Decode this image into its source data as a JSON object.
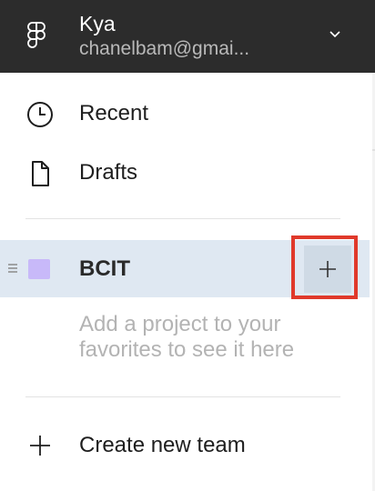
{
  "account": {
    "name": "Kya",
    "email": "chanelbam@gmai..."
  },
  "nav": {
    "recent_label": "Recent",
    "drafts_label": "Drafts"
  },
  "team": {
    "name": "BCIT",
    "swatch_color": "#c8b9f9"
  },
  "favorites": {
    "empty_message": "Add a project to your favorites to see it here"
  },
  "actions": {
    "create_team_label": "Create new team"
  },
  "icons": {
    "logo": "figma-logo-icon",
    "account_menu": "chevron-down-icon",
    "recent": "clock-icon",
    "drafts": "file-icon",
    "drag": "drag-handle-icon",
    "add": "plus-icon",
    "create_team": "plus-icon"
  },
  "colors": {
    "header_bg": "#2c2c2c",
    "selected_row_bg": "#dfe8f2",
    "highlight_border": "#e0392b"
  }
}
